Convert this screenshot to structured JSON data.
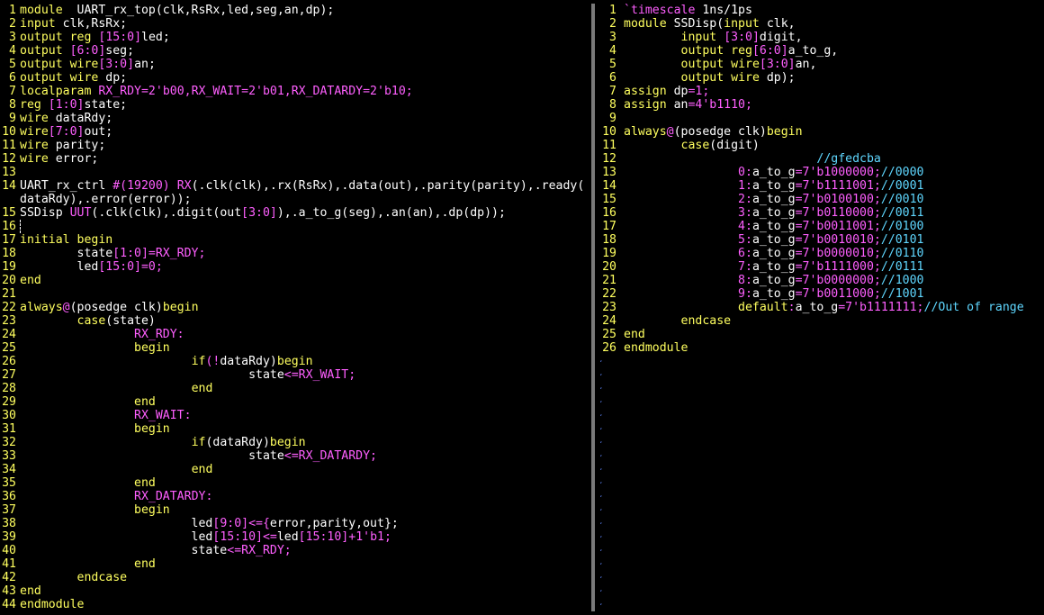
{
  "left": {
    "lines": [
      {
        "n": "1",
        "segs": [
          [
            "k",
            "module"
          ],
          [
            "",
            "  UART_rx_top(clk,RsRx,led,seg,an,dp);"
          ]
        ]
      },
      {
        "n": "2",
        "segs": [
          [
            "k",
            "input"
          ],
          [
            "",
            " clk,RsRx;"
          ]
        ]
      },
      {
        "n": "3",
        "segs": [
          [
            "k",
            "output"
          ],
          [
            "",
            " "
          ],
          [
            "k",
            "reg"
          ],
          [
            "",
            " "
          ],
          [
            "t",
            "[15:0]"
          ],
          [
            "",
            "led;"
          ]
        ]
      },
      {
        "n": "4",
        "segs": [
          [
            "k",
            "output"
          ],
          [
            "",
            " "
          ],
          [
            "t",
            "[6:0]"
          ],
          [
            "",
            "seg;"
          ]
        ]
      },
      {
        "n": "5",
        "segs": [
          [
            "k",
            "output"
          ],
          [
            "",
            " "
          ],
          [
            "k",
            "wire"
          ],
          [
            "t",
            "[3:0]"
          ],
          [
            "",
            "an;"
          ]
        ]
      },
      {
        "n": "6",
        "segs": [
          [
            "k",
            "output"
          ],
          [
            "",
            " "
          ],
          [
            "k",
            "wire"
          ],
          [
            "",
            " dp;"
          ]
        ]
      },
      {
        "n": "7",
        "segs": [
          [
            "k",
            "localparam"
          ],
          [
            "",
            " "
          ],
          [
            "t",
            "RX_RDY=2'b00,RX_WAIT=2'b01,RX_DATARDY=2'b10;"
          ]
        ]
      },
      {
        "n": "8",
        "segs": [
          [
            "k",
            "reg"
          ],
          [
            "",
            " "
          ],
          [
            "t",
            "[1:0]"
          ],
          [
            "",
            "state;"
          ]
        ]
      },
      {
        "n": "9",
        "segs": [
          [
            "k",
            "wire"
          ],
          [
            "",
            " dataRdy;"
          ]
        ]
      },
      {
        "n": "10",
        "segs": [
          [
            "k",
            "wire"
          ],
          [
            "t",
            "[7:0]"
          ],
          [
            "",
            "out;"
          ]
        ]
      },
      {
        "n": "11",
        "segs": [
          [
            "k",
            "wire"
          ],
          [
            "",
            " parity;"
          ]
        ]
      },
      {
        "n": "12",
        "segs": [
          [
            "k",
            "wire"
          ],
          [
            "",
            " error;"
          ]
        ]
      },
      {
        "n": "13",
        "segs": []
      },
      {
        "n": "14",
        "segs": [
          [
            "",
            "UART_rx_ctrl "
          ],
          [
            "t",
            "#(19200)"
          ],
          [
            "",
            " "
          ],
          [
            "t",
            "RX"
          ],
          [
            "",
            "(.clk(clk),.rx(RsRx),.data(out),.parity(parity),.ready("
          ]
        ]
      },
      {
        "n": "",
        "segs": [
          [
            "",
            "dataRdy),.error(error));"
          ]
        ]
      },
      {
        "n": "15",
        "segs": [
          [
            "",
            "SSDisp "
          ],
          [
            "t",
            "UUT"
          ],
          [
            "",
            "(.clk(clk),.digit(out"
          ],
          [
            "t",
            "[3:0]"
          ],
          [
            "",
            "),.a_to_g(seg),.an(an),.dp(dp));"
          ]
        ]
      },
      {
        "n": "16",
        "segs": [],
        "cursor": true
      },
      {
        "n": "17",
        "segs": [
          [
            "k",
            "initial"
          ],
          [
            "",
            " "
          ],
          [
            "k",
            "begin"
          ]
        ]
      },
      {
        "n": "18",
        "segs": [
          [
            "",
            "        state"
          ],
          [
            "t",
            "[1:0]"
          ],
          [
            "t",
            "=RX_RDY;"
          ]
        ]
      },
      {
        "n": "19",
        "segs": [
          [
            "",
            "        led"
          ],
          [
            "t",
            "[15:0]"
          ],
          [
            "t",
            "=0;"
          ]
        ]
      },
      {
        "n": "20",
        "segs": [
          [
            "k",
            "end"
          ]
        ]
      },
      {
        "n": "21",
        "segs": []
      },
      {
        "n": "22",
        "segs": [
          [
            "k",
            "always"
          ],
          [
            "t",
            "@"
          ],
          [
            "",
            "(posedge clk)"
          ],
          [
            "k",
            "begin"
          ]
        ]
      },
      {
        "n": "23",
        "segs": [
          [
            "",
            "        "
          ],
          [
            "k",
            "case"
          ],
          [
            "",
            "(state)"
          ]
        ]
      },
      {
        "n": "24",
        "segs": [
          [
            "",
            "                "
          ],
          [
            "t",
            "RX_RDY:"
          ]
        ]
      },
      {
        "n": "25",
        "segs": [
          [
            "",
            "                "
          ],
          [
            "k",
            "begin"
          ]
        ]
      },
      {
        "n": "26",
        "segs": [
          [
            "",
            "                        "
          ],
          [
            "k",
            "if"
          ],
          [
            "t",
            "(!"
          ],
          [
            "",
            "dataRdy)"
          ],
          [
            "k",
            "begin"
          ]
        ]
      },
      {
        "n": "27",
        "segs": [
          [
            "",
            "                                state"
          ],
          [
            "t",
            "<=RX_WAIT;"
          ]
        ]
      },
      {
        "n": "28",
        "segs": [
          [
            "",
            "                        "
          ],
          [
            "k",
            "end"
          ]
        ]
      },
      {
        "n": "29",
        "segs": [
          [
            "",
            "                "
          ],
          [
            "k",
            "end"
          ]
        ]
      },
      {
        "n": "30",
        "segs": [
          [
            "",
            "                "
          ],
          [
            "t",
            "RX_WAIT:"
          ]
        ]
      },
      {
        "n": "31",
        "segs": [
          [
            "",
            "                "
          ],
          [
            "k",
            "begin"
          ]
        ]
      },
      {
        "n": "32",
        "segs": [
          [
            "",
            "                        "
          ],
          [
            "k",
            "if"
          ],
          [
            "",
            "(dataRdy)"
          ],
          [
            "k",
            "begin"
          ]
        ]
      },
      {
        "n": "33",
        "segs": [
          [
            "",
            "                                state"
          ],
          [
            "t",
            "<=RX_DATARDY;"
          ]
        ]
      },
      {
        "n": "34",
        "segs": [
          [
            "",
            "                        "
          ],
          [
            "k",
            "end"
          ]
        ]
      },
      {
        "n": "35",
        "segs": [
          [
            "",
            "                "
          ],
          [
            "k",
            "end"
          ]
        ]
      },
      {
        "n": "36",
        "segs": [
          [
            "",
            "                "
          ],
          [
            "t",
            "RX_DATARDY:"
          ]
        ]
      },
      {
        "n": "37",
        "segs": [
          [
            "",
            "                "
          ],
          [
            "k",
            "begin"
          ]
        ]
      },
      {
        "n": "38",
        "segs": [
          [
            "",
            "                        led"
          ],
          [
            "t",
            "[9:0]"
          ],
          [
            "t",
            "<={"
          ],
          [
            "",
            "error,parity,out};"
          ]
        ]
      },
      {
        "n": "39",
        "segs": [
          [
            "",
            "                        led"
          ],
          [
            "t",
            "[15:10]"
          ],
          [
            "t",
            "<="
          ],
          [
            "",
            "led"
          ],
          [
            "t",
            "[15:10]"
          ],
          [
            "t",
            "+1'b1;"
          ]
        ]
      },
      {
        "n": "40",
        "segs": [
          [
            "",
            "                        state"
          ],
          [
            "t",
            "<=RX_RDY;"
          ]
        ]
      },
      {
        "n": "41",
        "segs": [
          [
            "",
            "                "
          ],
          [
            "k",
            "end"
          ]
        ]
      },
      {
        "n": "42",
        "segs": [
          [
            "",
            "        "
          ],
          [
            "k",
            "endcase"
          ]
        ]
      },
      {
        "n": "43",
        "segs": [
          [
            "k",
            "end"
          ]
        ]
      },
      {
        "n": "44",
        "segs": [
          [
            "k",
            "endmodule"
          ]
        ]
      }
    ]
  },
  "right": {
    "lines": [
      {
        "n": "1",
        "segs": [
          [
            "t",
            "`timescale"
          ],
          [
            "",
            " 1ns/1ps"
          ]
        ]
      },
      {
        "n": "2",
        "segs": [
          [
            "k",
            "module"
          ],
          [
            "",
            " SSDisp("
          ],
          [
            "k",
            "input"
          ],
          [
            "",
            " clk,"
          ]
        ]
      },
      {
        "n": "3",
        "segs": [
          [
            "",
            "        "
          ],
          [
            "k",
            "input"
          ],
          [
            "",
            " "
          ],
          [
            "t",
            "[3:0]"
          ],
          [
            "",
            "digit,"
          ]
        ]
      },
      {
        "n": "4",
        "segs": [
          [
            "",
            "        "
          ],
          [
            "k",
            "output"
          ],
          [
            "",
            " "
          ],
          [
            "k",
            "reg"
          ],
          [
            "t",
            "[6:0]"
          ],
          [
            "",
            "a_to_g,"
          ]
        ]
      },
      {
        "n": "5",
        "segs": [
          [
            "",
            "        "
          ],
          [
            "k",
            "output"
          ],
          [
            "",
            " "
          ],
          [
            "k",
            "wire"
          ],
          [
            "t",
            "[3:0]"
          ],
          [
            "",
            "an,"
          ]
        ]
      },
      {
        "n": "6",
        "segs": [
          [
            "",
            "        "
          ],
          [
            "k",
            "output"
          ],
          [
            "",
            " "
          ],
          [
            "k",
            "wire"
          ],
          [
            "",
            " dp);"
          ]
        ]
      },
      {
        "n": "7",
        "segs": [
          [
            "k",
            "assign"
          ],
          [
            "",
            " dp"
          ],
          [
            "t",
            "=1;"
          ]
        ]
      },
      {
        "n": "8",
        "segs": [
          [
            "k",
            "assign"
          ],
          [
            "",
            " an"
          ],
          [
            "t",
            "=4'b1110;"
          ]
        ]
      },
      {
        "n": "9",
        "segs": []
      },
      {
        "n": "10",
        "segs": [
          [
            "k",
            "always"
          ],
          [
            "t",
            "@"
          ],
          [
            "",
            "(posedge clk)"
          ],
          [
            "k",
            "begin"
          ]
        ]
      },
      {
        "n": "11",
        "segs": [
          [
            "",
            "        "
          ],
          [
            "k",
            "case"
          ],
          [
            "",
            "(digit)"
          ]
        ]
      },
      {
        "n": "12",
        "segs": [
          [
            "",
            "                           "
          ],
          [
            "c",
            "//gfedcba"
          ]
        ]
      },
      {
        "n": "13",
        "segs": [
          [
            "",
            "                "
          ],
          [
            "t",
            "0:"
          ],
          [
            "",
            "a_to_g"
          ],
          [
            "t",
            "=7'b1000000;"
          ],
          [
            "c",
            "//0000"
          ]
        ]
      },
      {
        "n": "14",
        "segs": [
          [
            "",
            "                "
          ],
          [
            "t",
            "1:"
          ],
          [
            "",
            "a_to_g"
          ],
          [
            "t",
            "=7'b1111001;"
          ],
          [
            "c",
            "//0001"
          ]
        ]
      },
      {
        "n": "15",
        "segs": [
          [
            "",
            "                "
          ],
          [
            "t",
            "2:"
          ],
          [
            "",
            "a_to_g"
          ],
          [
            "t",
            "=7'b0100100;"
          ],
          [
            "c",
            "//0010"
          ]
        ]
      },
      {
        "n": "16",
        "segs": [
          [
            "",
            "                "
          ],
          [
            "t",
            "3:"
          ],
          [
            "",
            "a_to_g"
          ],
          [
            "t",
            "=7'b0110000;"
          ],
          [
            "c",
            "//0011"
          ]
        ]
      },
      {
        "n": "17",
        "segs": [
          [
            "",
            "                "
          ],
          [
            "t",
            "4:"
          ],
          [
            "",
            "a_to_g"
          ],
          [
            "t",
            "=7'b0011001;"
          ],
          [
            "c",
            "//0100"
          ]
        ]
      },
      {
        "n": "18",
        "segs": [
          [
            "",
            "                "
          ],
          [
            "t",
            "5:"
          ],
          [
            "",
            "a_to_g"
          ],
          [
            "t",
            "=7'b0010010;"
          ],
          [
            "c",
            "//0101"
          ]
        ]
      },
      {
        "n": "19",
        "segs": [
          [
            "",
            "                "
          ],
          [
            "t",
            "6:"
          ],
          [
            "",
            "a_to_g"
          ],
          [
            "t",
            "=7'b0000010;"
          ],
          [
            "c",
            "//0110"
          ]
        ]
      },
      {
        "n": "20",
        "segs": [
          [
            "",
            "                "
          ],
          [
            "t",
            "7:"
          ],
          [
            "",
            "a_to_g"
          ],
          [
            "t",
            "=7'b1111000;"
          ],
          [
            "c",
            "//0111"
          ]
        ]
      },
      {
        "n": "21",
        "segs": [
          [
            "",
            "                "
          ],
          [
            "t",
            "8:"
          ],
          [
            "",
            "a_to_g"
          ],
          [
            "t",
            "=7'b0000000;"
          ],
          [
            "c",
            "//1000"
          ]
        ]
      },
      {
        "n": "22",
        "segs": [
          [
            "",
            "                "
          ],
          [
            "t",
            "9:"
          ],
          [
            "",
            "a_to_g"
          ],
          [
            "t",
            "=7'b0011000;"
          ],
          [
            "c",
            "//1001"
          ]
        ]
      },
      {
        "n": "23",
        "segs": [
          [
            "",
            "                "
          ],
          [
            "k",
            "default"
          ],
          [
            "t",
            ":"
          ],
          [
            "",
            "a_to_g"
          ],
          [
            "t",
            "=7'b1111111;"
          ],
          [
            "c",
            "//Out of range"
          ]
        ]
      },
      {
        "n": "24",
        "segs": [
          [
            "",
            "        "
          ],
          [
            "k",
            "endcase"
          ]
        ]
      },
      {
        "n": "25",
        "segs": [
          [
            "k",
            "end"
          ]
        ]
      },
      {
        "n": "26",
        "segs": [
          [
            "k",
            "endmodule"
          ]
        ]
      }
    ],
    "tilde": "~"
  }
}
